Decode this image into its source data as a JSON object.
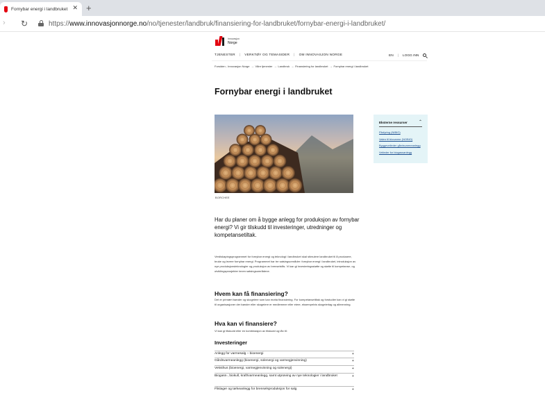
{
  "browser": {
    "tab_title": "Fornybar energi i landbruket",
    "tab_close": "✕",
    "new_tab": "+",
    "url_prefix": "https://",
    "url_host": "www.innovasjonnorge.no",
    "url_path": "/no/tjenester/landbruk/finansiering-for-landbruket/fornybar-energi-i-landbruket/"
  },
  "logo": {
    "small": "Innovasjon",
    "big": "Norge"
  },
  "nav": {
    "items": [
      "TJENESTER",
      "VERKTØY OG TEMASIDER",
      "OM INNOVASJON NORGE"
    ],
    "lang": "EN",
    "login": "LOGG INN"
  },
  "breadcrumb": [
    "Forsiden - Innovasjon Norge",
    "→",
    "Våre tjenester",
    "→",
    "Landbruk",
    "→",
    "Finansiering for landbruket",
    "→",
    "Fornybar energi i landbruket"
  ],
  "page_title": "Fornybar energi i landbruket",
  "hero_credit": "BORCHEE",
  "sidebar": {
    "title": "Eksterne ressurser",
    "links": [
      "Flisfyring (NIBIO)",
      "Valen til biovarme (NOBIO)",
      "Byggeveileder gårdsvarmeanlegg",
      "Veileder for biogassanlegg"
    ]
  },
  "lead": "Har du planer om å bygge anlegg for produksjon av fornybar energi? Vi gir tilskudd til investeringer, utredninger og kompetansetiltak.",
  "intro": "Verdiskapingsprogrammet for fornybar energi og teknologi i landbruket skal stimulere landbruket til å produsere, bruke og levere fornybar energi. Programmet har tre satsingsområder: fornybar energi i landbruket, introduksjon av nye produksjonsteknologier og produksjon av brenselsflis. Vi kan gi investeringsstøtte og støtte til kompetanse- og utviklingsprosjekter innen satsingsområdene.",
  "section1": {
    "title": "Hvem kan få finansiering?",
    "body": "Det er primært bønder og skogeiere som kan motta finansiering. For kompetansetiltak og forstudier kan vi gi støtte til organisasjoner der bønder eller skogeiere er medlemmer eller eiere, eksempelvis skogeierlag og allmenning."
  },
  "section2": {
    "title": "Hva kan vi finansiere?",
    "body": "Vi kan gi tilskudd eller en kombinasjon av tilskudd og lån til:"
  },
  "investments": {
    "title": "Investeringer",
    "items": [
      "Anlegg for varmesalg – bioenergi",
      "Gårdsvarmeanlegg (bioenergi, solenergi og varmegjenvinning)",
      "Veksthus (bioenergi, varmegjenvinning og solenergi)",
      "Biogass-, biokull, kraft/varmeanlegg, samt utprøving av nye teknologier i landbruket",
      "Flislager og tørkeanlegg for brenselsproduksjon for salg"
    ],
    "expand_symbol": "+"
  }
}
